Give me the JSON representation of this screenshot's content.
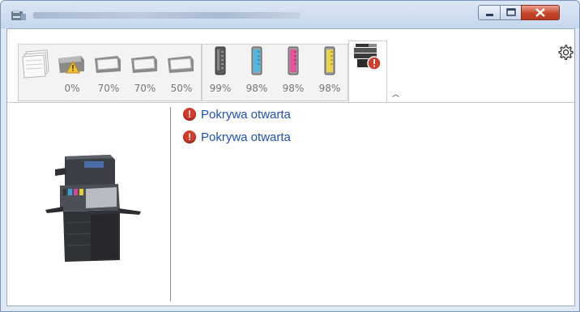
{
  "titlebar": {
    "icon": "printer-app-icon",
    "controls": [
      "minimize-icon",
      "maximize-icon",
      "close-icon"
    ]
  },
  "toolbar": {
    "paper_trays": [
      {
        "icon": "paper-stack-icon",
        "percent": ""
      },
      {
        "icon": "paper-tray-warning-icon",
        "percent": "0%"
      },
      {
        "icon": "paper-tray-icon",
        "percent": "70%"
      },
      {
        "icon": "paper-tray-icon",
        "percent": "70%"
      },
      {
        "icon": "paper-tray-icon",
        "percent": "50%"
      }
    ],
    "toners": [
      {
        "color": "#555555",
        "percent": "99%"
      },
      {
        "color": "#4fb7e6",
        "percent": "98%"
      },
      {
        "color": "#e0559e",
        "percent": "98%"
      },
      {
        "color": "#ead24a",
        "percent": "98%"
      }
    ],
    "status_tab_icon": "printer-error-icon",
    "settings_icon": "gear-icon",
    "collapse_icon": "chevron-up-icon"
  },
  "messages": [
    {
      "icon": "error-icon",
      "text": "Pokrywa otwarta"
    },
    {
      "icon": "error-icon",
      "text": "Pokrywa otwarta"
    }
  ],
  "device_image": "multifunction-printer-image"
}
